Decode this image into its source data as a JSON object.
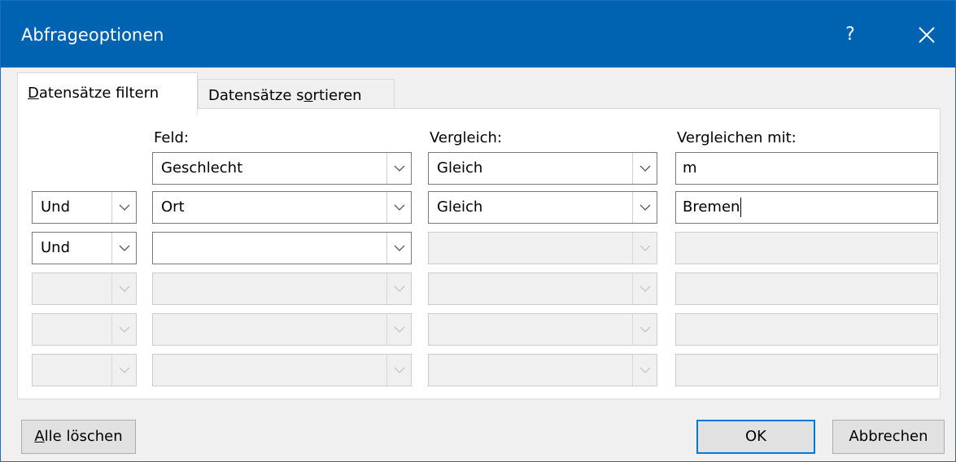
{
  "window": {
    "title": "Abfrageoptionen",
    "help_label": "?",
    "accent_color": "#0063b1"
  },
  "tabs": [
    {
      "pre": "",
      "accel": "D",
      "post": "atensätze filtern",
      "active": true
    },
    {
      "pre": "Datensätze s",
      "accel": "o",
      "post": "rtieren",
      "active": false
    }
  ],
  "headers": {
    "field": "Feld:",
    "comparison": "Vergleich:",
    "compare_with": "Vergleichen mit:"
  },
  "rows": [
    {
      "connector": "",
      "field": "Geschlecht",
      "comparison": "Gleich",
      "value": "m",
      "enabled": true
    },
    {
      "connector": "Und",
      "field": "Ort",
      "comparison": "Gleich",
      "value": "Bremen",
      "enabled": true
    },
    {
      "connector": "Und",
      "field": "",
      "comparison": "",
      "value": "",
      "enabled": "partial"
    },
    {
      "connector": "",
      "field": "",
      "comparison": "",
      "value": "",
      "enabled": false
    },
    {
      "connector": "",
      "field": "",
      "comparison": "",
      "value": "",
      "enabled": false
    },
    {
      "connector": "",
      "field": "",
      "comparison": "",
      "value": "",
      "enabled": false
    }
  ],
  "buttons": {
    "clear_all": {
      "accel": "A",
      "post": "lle löschen"
    },
    "ok": "OK",
    "cancel": "Abbrechen"
  }
}
